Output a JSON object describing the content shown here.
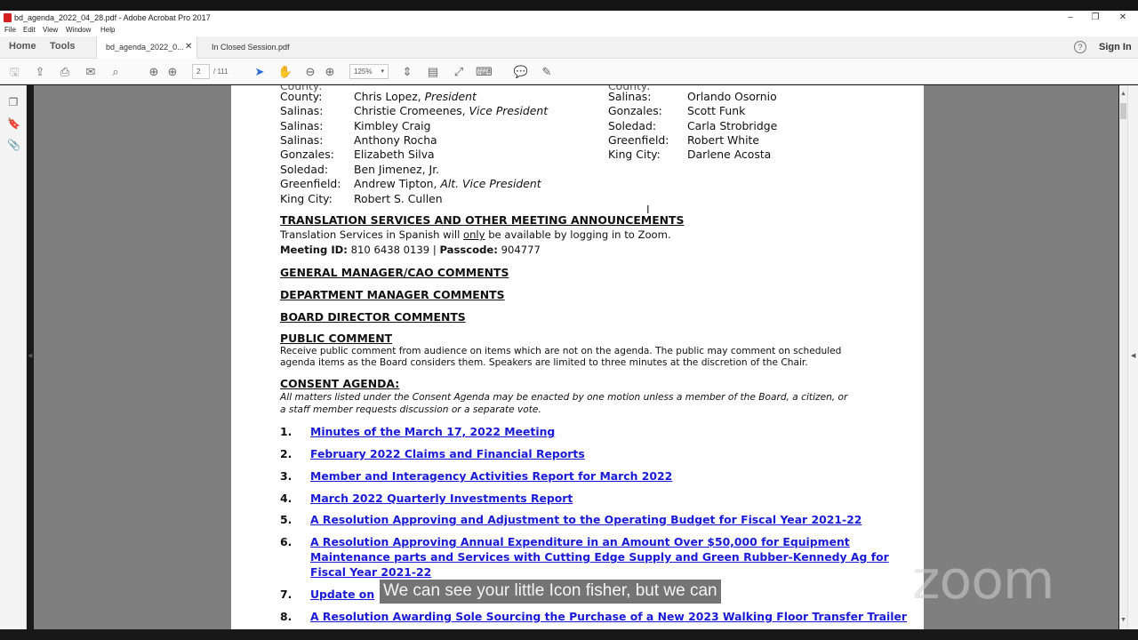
{
  "window": {
    "title": "bd_agenda_2022_04_28.pdf - Adobe Acrobat Pro 2017",
    "controls": [
      "–",
      "❐",
      "✕"
    ]
  },
  "menu": [
    "File",
    "Edit",
    "View",
    "Window",
    "Help"
  ],
  "tabs": {
    "home": "Home",
    "tools": "Tools",
    "documents": [
      {
        "label": "bd_agenda_2022_0...",
        "active": true
      },
      {
        "label": "In Closed Session.pdf",
        "active": false
      }
    ],
    "help": "?",
    "signin": "Sign In"
  },
  "toolbar": {
    "page_current": "2",
    "page_total": "/ 111",
    "zoom": "125%"
  },
  "document": {
    "board_left": [
      {
        "city": "County:",
        "name": "Chris Lopez, ",
        "title": "President"
      },
      {
        "city": "Salinas:",
        "name": "Christie Cromeenes, ",
        "title": "Vice President"
      },
      {
        "city": "Salinas:",
        "name": "Kimbley Craig",
        "title": ""
      },
      {
        "city": "Salinas:",
        "name": "Anthony Rocha",
        "title": ""
      },
      {
        "city": "Gonzales:",
        "name": "Elizabeth Silva",
        "title": ""
      },
      {
        "city": "Soledad:",
        "name": "Ben Jimenez, Jr.",
        "title": ""
      },
      {
        "city": "Greenfield:",
        "name": "Andrew Tipton, ",
        "title": "Alt. Vice President"
      },
      {
        "city": "King City:",
        "name": "Robert S. Cullen",
        "title": ""
      }
    ],
    "board_right": [
      {
        "city": "Salinas:",
        "name": "Orlando Osornio"
      },
      {
        "city": "Gonzales:",
        "name": "Scott Funk"
      },
      {
        "city": "Soledad:",
        "name": "Carla Strobridge"
      },
      {
        "city": "Greenfield:",
        "name": "Robert White"
      },
      {
        "city": "King City:",
        "name": "Darlene Acosta"
      }
    ],
    "translation_heading": "TRANSLATION SERVICES AND OTHER MEETING ANNOUNCEMENTS",
    "translation_text_a": "Translation Services in Spanish will ",
    "translation_text_only": "only",
    "translation_text_b": " be available by logging in to Zoom.",
    "meeting_id_label": "Meeting ID:",
    "meeting_id": " 810 6438 0139 | ",
    "passcode_label": "Passcode:",
    "passcode": " 904777",
    "gm_heading": "GENERAL MANAGER/CAO COMMENTS",
    "dept_heading": "DEPARTMENT MANAGER COMMENTS",
    "board_heading": "BOARD DIRECTOR COMMENTS",
    "public_heading": "PUBLIC COMMENT",
    "public_line1": "Receive public comment from audience on items which are not on the agenda. The public may comment on scheduled",
    "public_line2": "agenda items as the Board considers them. Speakers are limited to three minutes at the discretion of the Chair.",
    "consent_heading": "CONSENT AGENDA:",
    "consent_line1": "All matters listed under the Consent Agenda may be enacted by one motion unless a member of the Board, a citizen, or",
    "consent_line2": "a staff member requests discussion or a separate vote.",
    "items": [
      {
        "num": "1.",
        "lines": [
          "Minutes of the March 17, 2022 Meeting"
        ]
      },
      {
        "num": "2.",
        "lines": [
          "February 2022 Claims and Financial Reports"
        ]
      },
      {
        "num": "3.",
        "lines": [
          "Member and Interagency Activities Report for March 2022"
        ]
      },
      {
        "num": "4.",
        "lines": [
          "March 2022 Quarterly Investments Report"
        ]
      },
      {
        "num": "5.",
        "lines": [
          "A Resolution Approving and Adjustment to the Operating Budget for Fiscal Year 2021-22"
        ]
      },
      {
        "num": "6.",
        "lines": [
          "A Resolution Approving Annual Expenditure in an Amount Over $50,000 for Equipment",
          "Maintenance parts and Services with Cutting Edge Supply and Green Rubber-Kennedy Ag for",
          "Fiscal Year 2021-22"
        ]
      },
      {
        "num": "7.",
        "lines": [
          "Update on"
        ]
      },
      {
        "num": "8.",
        "lines": [
          "A Resolution Awarding Sole Sourcing the Purchase of a New 2023 Walking Floor Transfer Trailer"
        ]
      }
    ]
  },
  "overlay": {
    "caption": "We can see your little Icon fisher, but we can",
    "watermark": "zoom"
  }
}
